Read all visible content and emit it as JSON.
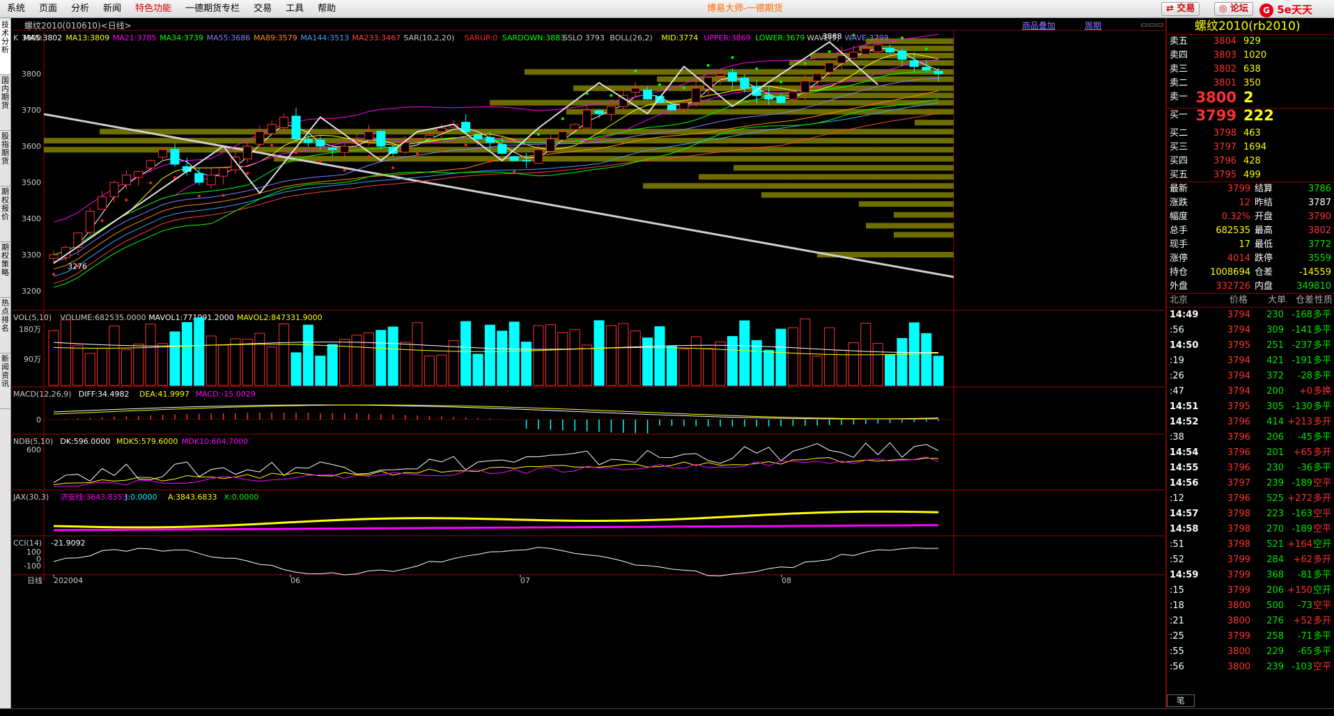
{
  "menu": [
    "系统",
    "页面",
    "分析",
    "新闻",
    "特色功能",
    "一德期货专栏",
    "交易",
    "工具",
    "帮助"
  ],
  "app_title": "博易大师-一德期货",
  "buttons": {
    "trade": "交易",
    "forum": "论坛"
  },
  "logo": "5e天天",
  "left_tabs": [
    "技术分析",
    "国内期货",
    "股指期货",
    "期权报价",
    "期权策略",
    "热点排名",
    "新闻资讯"
  ],
  "chart": {
    "title": "螺纹2010(010610)<日线>",
    "links": [
      "商品叠加",
      "周期"
    ],
    "price_indicators": [
      {
        "t": "K",
        "c": "#cccccc"
      },
      {
        "t": "MA5:3802",
        "c": "#ffffff"
      },
      {
        "t": "MA13:3809",
        "c": "#ffff00"
      },
      {
        "t": "MA21:3785",
        "c": "#ff00ff"
      },
      {
        "t": "MA34:3739",
        "c": "#00ff00"
      },
      {
        "t": "MA55:3686",
        "c": "#8080ff"
      },
      {
        "t": "MA89:3579",
        "c": "#ff8c00"
      },
      {
        "t": "MA144:3513",
        "c": "#40a0ff"
      },
      {
        "t": "MA233:3467",
        "c": "#ff4040"
      },
      {
        "t": "SAR(10,2,20)",
        "c": "#cccccc"
      },
      {
        "t": "SARUP:0",
        "c": "#ff2020"
      },
      {
        "t": "SARDOWN:3883",
        "c": "#00ff00"
      },
      {
        "t": "SSLO 3793",
        "c": "#cccccc"
      },
      {
        "t": "BOLL(26,2)",
        "c": "#cccccc"
      },
      {
        "t": "MID:3774",
        "c": "#ffff00"
      },
      {
        "t": "UPPER:3869",
        "c": "#ff00ff"
      },
      {
        "t": "LOWER:3679",
        "c": "#00ff00"
      },
      {
        "t": "WAVE(5)",
        "c": "#cccccc"
      },
      {
        "t": "WAVE:3799",
        "c": "#8080ff"
      }
    ],
    "price_ticks": [
      "3900",
      "3800",
      "3700",
      "3600",
      "3500",
      "3400",
      "3300",
      "3200"
    ],
    "price_labels": {
      "high": "3888",
      "low": "3276"
    },
    "vol_header": [
      {
        "t": "VOL(5,10)",
        "c": "#cccccc"
      },
      {
        "t": "VOLUME:682535.0000",
        "c": "#cccccc"
      },
      {
        "t": "MAVOL1:771991.2000",
        "c": "#ffffff"
      },
      {
        "t": "MAVOL2:847331.9000",
        "c": "#ffff00"
      }
    ],
    "vol_ticks": [
      "180万",
      "90万"
    ],
    "macd_header": [
      {
        "t": "MACD(12,26,9)",
        "c": "#cccccc"
      },
      {
        "t": "DIFF:34.4982",
        "c": "#ffffff"
      },
      {
        "t": "DEA:41.9997",
        "c": "#ffff00"
      },
      {
        "t": "MACD:-15.0029",
        "c": "#ff00ff"
      }
    ],
    "macd_ticks": [
      "0"
    ],
    "ndb_header": [
      {
        "t": "NDB(5,10)",
        "c": "#cccccc"
      },
      {
        "t": "DK:596.0000",
        "c": "#ffffff"
      },
      {
        "t": "MDK5:579.6000",
        "c": "#ffff00"
      },
      {
        "t": "MDK10:604.7000",
        "c": "#ff00ff"
      }
    ],
    "ndb_ticks": [
      "600"
    ],
    "jax_header": [
      {
        "t": "JAX(30,3)",
        "c": "#cccccc"
      },
      {
        "t": "济安线:3643.8353",
        "c": "#ff00ff"
      },
      {
        "t": "J:0.0000",
        "c": "#00ffff"
      },
      {
        "t": "A:3843.6833",
        "c": "#ffff00"
      },
      {
        "t": "X:0.0000",
        "c": "#00ff00"
      }
    ],
    "cci_header": [
      {
        "t": "CCI(14)",
        "c": "#cccccc"
      },
      {
        "t": "-21.9092",
        "c": "#ffffff"
      }
    ],
    "cci_ticks": [
      "100",
      "0",
      "-100"
    ],
    "x_labels": [
      "日线",
      "202004",
      "06",
      "07",
      "08"
    ]
  },
  "quote": {
    "title": "螺纹2010(rb2010)",
    "asks": [
      {
        "label": "卖五",
        "price": "3804",
        "vol": "929"
      },
      {
        "label": "卖四",
        "price": "3803",
        "vol": "1020"
      },
      {
        "label": "卖三",
        "price": "3802",
        "vol": "638"
      },
      {
        "label": "卖二",
        "price": "3801",
        "vol": "350"
      },
      {
        "label": "卖一",
        "price": "3800",
        "vol": "2"
      }
    ],
    "bids": [
      {
        "label": "买一",
        "price": "3799",
        "vol": "222"
      },
      {
        "label": "买二",
        "price": "3798",
        "vol": "463"
      },
      {
        "label": "买三",
        "price": "3797",
        "vol": "1694"
      },
      {
        "label": "买四",
        "price": "3796",
        "vol": "428"
      },
      {
        "label": "买五",
        "price": "3795",
        "vol": "499"
      }
    ],
    "stats": [
      [
        {
          "l": "最新",
          "v": "3799",
          "c": "red"
        },
        {
          "l": "结算",
          "v": "3786",
          "c": "green"
        }
      ],
      [
        {
          "l": "涨跌",
          "v": "12",
          "c": "red"
        },
        {
          "l": "昨结",
          "v": "3787",
          "c": "white"
        }
      ],
      [
        {
          "l": "幅度",
          "v": "0.32%",
          "c": "red"
        },
        {
          "l": "开盘",
          "v": "3790",
          "c": "red"
        }
      ],
      [
        {
          "l": "总手",
          "v": "682535",
          "c": "yellow"
        },
        {
          "l": "最高",
          "v": "3802",
          "c": "red"
        }
      ],
      [
        {
          "l": "现手",
          "v": "17",
          "c": "yellow"
        },
        {
          "l": "最低",
          "v": "3772",
          "c": "green"
        }
      ],
      [
        {
          "l": "涨停",
          "v": "4014",
          "c": "red"
        },
        {
          "l": "跌停",
          "v": "3559",
          "c": "green"
        }
      ],
      [
        {
          "l": "持仓",
          "v": "1008694",
          "c": "yellow"
        },
        {
          "l": "仓差",
          "v": "-14559",
          "c": "yellow"
        }
      ],
      [
        {
          "l": "外盘",
          "v": "332726",
          "c": "red"
        },
        {
          "l": "内盘",
          "v": "349810",
          "c": "green"
        }
      ]
    ],
    "tick_headers": [
      "北京",
      "价格",
      "大单",
      "仓差",
      "性质"
    ],
    "ticks": [
      {
        "t": "14:49",
        "p": "3794",
        "v": "230",
        "d": "-168",
        "n": "多平",
        "nc": "green"
      },
      {
        "t": ":56",
        "p": "3794",
        "v": "309",
        "d": "-141",
        "n": "多平",
        "nc": "green"
      },
      {
        "t": "14:50",
        "p": "3795",
        "v": "251",
        "d": "-237",
        "n": "多平",
        "nc": "green"
      },
      {
        "t": ":19",
        "p": "3794",
        "v": "421",
        "d": "-191",
        "n": "多平",
        "nc": "green"
      },
      {
        "t": ":26",
        "p": "3794",
        "v": "372",
        "d": "-28",
        "n": "多平",
        "nc": "green"
      },
      {
        "t": ":47",
        "p": "3794",
        "v": "200",
        "d": "+0",
        "n": "多换",
        "nc": "red"
      },
      {
        "t": "14:51",
        "p": "3795",
        "v": "305",
        "d": "-130",
        "n": "多平",
        "nc": "green"
      },
      {
        "t": "14:52",
        "p": "3796",
        "v": "414",
        "d": "+213",
        "n": "多开",
        "nc": "red"
      },
      {
        "t": ":38",
        "p": "3796",
        "v": "206",
        "d": "-45",
        "n": "多平",
        "nc": "green"
      },
      {
        "t": "14:54",
        "p": "3796",
        "v": "201",
        "d": "+65",
        "n": "多开",
        "nc": "red"
      },
      {
        "t": "14:55",
        "p": "3796",
        "v": "230",
        "d": "-36",
        "n": "多平",
        "nc": "green"
      },
      {
        "t": "14:56",
        "p": "3797",
        "v": "239",
        "d": "-189",
        "n": "空平",
        "nc": "red"
      },
      {
        "t": ":12",
        "p": "3796",
        "v": "525",
        "d": "+272",
        "n": "多开",
        "nc": "red"
      },
      {
        "t": "14:57",
        "p": "3798",
        "v": "223",
        "d": "-163",
        "n": "空平",
        "nc": "red"
      },
      {
        "t": "14:58",
        "p": "3798",
        "v": "270",
        "d": "-189",
        "n": "空平",
        "nc": "red"
      },
      {
        "t": ":51",
        "p": "3798",
        "v": "521",
        "d": "+164",
        "n": "空开",
        "nc": "green"
      },
      {
        "t": ":52",
        "p": "3799",
        "v": "284",
        "d": "+62",
        "n": "多开",
        "nc": "red"
      },
      {
        "t": "14:59",
        "p": "3799",
        "v": "368",
        "d": "-81",
        "n": "多平",
        "nc": "green"
      },
      {
        "t": ":15",
        "p": "3799",
        "v": "206",
        "d": "+150",
        "n": "空开",
        "nc": "green"
      },
      {
        "t": ":18",
        "p": "3800",
        "v": "500",
        "d": "-73",
        "n": "空平",
        "nc": "red"
      },
      {
        "t": ":21",
        "p": "3800",
        "v": "276",
        "d": "+52",
        "n": "多开",
        "nc": "red"
      },
      {
        "t": ":25",
        "p": "3799",
        "v": "258",
        "d": "-71",
        "n": "多平",
        "nc": "green"
      },
      {
        "t": ":55",
        "p": "3800",
        "v": "229",
        "d": "-65",
        "n": "多平",
        "nc": "green"
      },
      {
        "t": ":56",
        "p": "3800",
        "v": "239",
        "d": "-103",
        "n": "空平",
        "nc": "red"
      }
    ],
    "footer_tab": "笔"
  },
  "colors": {
    "up": "#ff3030",
    "down": "#00ffff",
    "grid": "#800000",
    "volbar": "#808000"
  }
}
